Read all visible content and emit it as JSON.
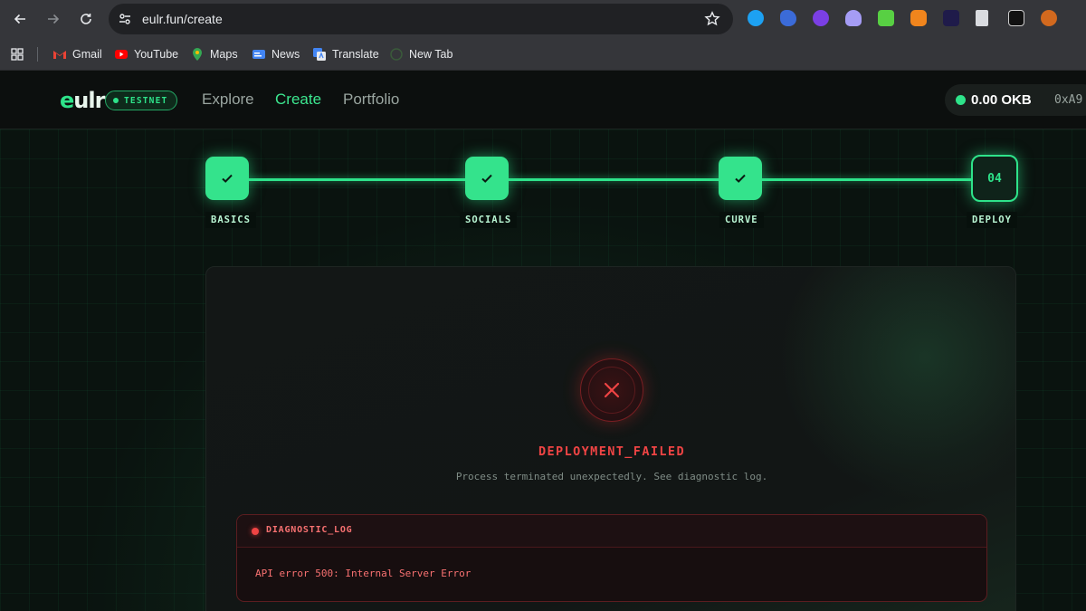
{
  "browser": {
    "url": "eulr.fun/create",
    "bookmarks": [
      {
        "label": "Gmail"
      },
      {
        "label": "YouTube"
      },
      {
        "label": "Maps"
      },
      {
        "label": "News"
      },
      {
        "label": "Translate"
      },
      {
        "label": "New Tab"
      }
    ]
  },
  "app": {
    "logo_e": "e",
    "logo_rest": "ulr",
    "network_badge": "TESTNET",
    "nav": [
      {
        "label": "Explore",
        "active": false
      },
      {
        "label": "Create",
        "active": true
      },
      {
        "label": "Portfolio",
        "active": false
      }
    ],
    "wallet": {
      "balance": "0.00 OKB",
      "address": "0xA9"
    }
  },
  "stepper": {
    "steps": [
      {
        "label": "BASICS",
        "status": "done"
      },
      {
        "label": "SOCIALS",
        "status": "done"
      },
      {
        "label": "CURVE",
        "status": "done"
      },
      {
        "label": "DEPLOY",
        "status": "current",
        "number": "04"
      }
    ]
  },
  "result": {
    "title": "DEPLOYMENT_FAILED",
    "subtitle": "Process terminated unexpectedly. See diagnostic log.",
    "log_title": "DIAGNOSTIC_LOG",
    "log_message": "API error 500: Internal Server Error"
  },
  "colors": {
    "accent": "#2ee38a",
    "error": "#ef4444",
    "background": "#0a130f"
  }
}
